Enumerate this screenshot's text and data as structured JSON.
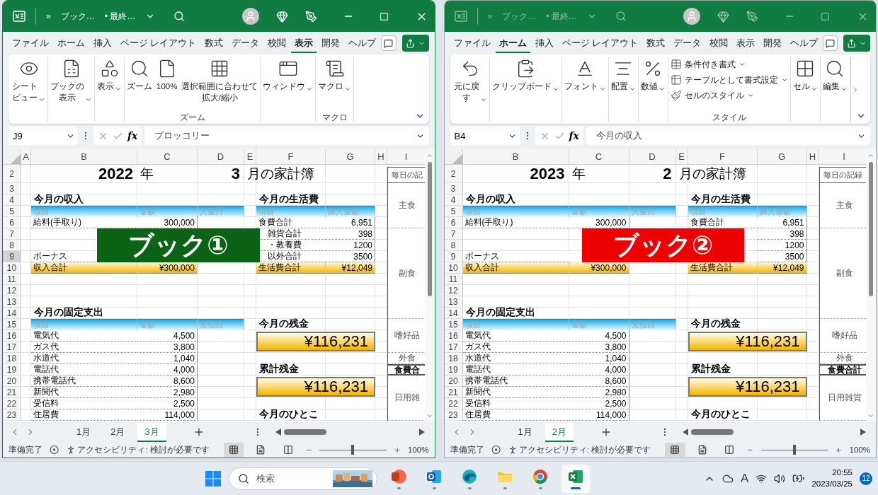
{
  "windows": [
    {
      "active": true,
      "title": {
        "more": "»",
        "name": "ブック…",
        "status": "• 最終…"
      },
      "menu_tabs": [
        {
          "label": "ファイル",
          "selected": false
        },
        {
          "label": "ホーム",
          "selected": false
        },
        {
          "label": "挿入",
          "selected": false
        },
        {
          "label": "ページ レイアウト",
          "selected": false
        },
        {
          "label": "数式",
          "selected": false
        },
        {
          "label": "データ",
          "selected": false
        },
        {
          "label": "校閲",
          "selected": false
        },
        {
          "label": "表示",
          "selected": true
        },
        {
          "label": "開発",
          "selected": false
        },
        {
          "label": "ヘルプ",
          "selected": false
        }
      ],
      "ribbon": {
        "more": false,
        "groups": [
          {
            "kind": "row",
            "items": [
              {
                "kind": "eye",
                "lines": [
                  "シート",
                  "ビュー"
                ],
                "dropdown": true
              }
            ]
          },
          {
            "kind": "row",
            "items": [
              {
                "kind": "book",
                "lines": [
                  "ブックの",
                  "表示"
                ],
                "dropdown": true
              }
            ]
          },
          {
            "kind": "row",
            "items": [
              {
                "kind": "display",
                "lines": [
                  "表示"
                ],
                "dropdown": true
              }
            ]
          },
          {
            "kind": "row",
            "label": "ズーム",
            "items": [
              {
                "kind": "zoom",
                "lines": [
                  "ズーム"
                ],
                "dropdown": false
              },
              {
                "kind": "page",
                "lines": [
                  "100%"
                ],
                "dropdown": false
              },
              {
                "kind": "fit",
                "lines": [
                  "選択範囲に合わせて",
                  "拡大/縮小"
                ],
                "dropdown": false
              }
            ]
          },
          {
            "kind": "row",
            "items": [
              {
                "kind": "window",
                "lines": [
                  "ウィンドウ"
                ],
                "dropdown": true
              }
            ]
          },
          {
            "kind": "row",
            "label": "マクロ",
            "items": [
              {
                "kind": "macro",
                "lines": [
                  "マクロ"
                ],
                "dropdown": true
              }
            ]
          }
        ]
      },
      "formula_bar": {
        "name_box": "J9",
        "fx": "fx",
        "value": "ブロッコリー"
      },
      "sheet": {
        "columns": [
          {
            "label": "A",
            "kind": "tiny"
          },
          {
            "label": "B",
            "kind": "wide"
          },
          {
            "label": "C",
            "kind": "mid"
          },
          {
            "label": "D",
            "kind": "short"
          },
          {
            "label": "E",
            "kind": "narrow"
          },
          {
            "label": "F",
            "kind": "broad"
          },
          {
            "label": "G",
            "kind": "medium"
          },
          {
            "label": "H",
            "kind": "narrow"
          },
          {
            "label": "I",
            "kind": "clipped"
          }
        ],
        "rows": [
          {
            "label": "2",
            "tall": true,
            "selected": false
          },
          {
            "label": "3",
            "tall": false,
            "selected": false
          },
          {
            "label": "4",
            "tall": false,
            "selected": false
          },
          {
            "label": "5",
            "tall": false,
            "selected": false
          },
          {
            "label": "6",
            "tall": false,
            "selected": false
          },
          {
            "label": "7",
            "tall": false,
            "selected": false
          },
          {
            "label": "8",
            "tall": false,
            "selected": false
          },
          {
            "label": "9",
            "tall": false,
            "selected": true
          },
          {
            "label": "10",
            "tall": false,
            "selected": false
          },
          {
            "label": "11",
            "tall": false,
            "selected": false
          },
          {
            "label": "12",
            "tall": false,
            "selected": false
          },
          {
            "label": "13",
            "tall": false,
            "selected": false
          },
          {
            "label": "14",
            "tall": false,
            "selected": false
          },
          {
            "label": "15",
            "tall": false,
            "selected": false
          },
          {
            "label": "16",
            "tall": false,
            "selected": false
          },
          {
            "label": "17",
            "tall": false,
            "selected": false
          },
          {
            "label": "18",
            "tall": false,
            "selected": false
          },
          {
            "label": "19",
            "tall": false,
            "selected": false
          },
          {
            "label": "20",
            "tall": false,
            "selected": false
          },
          {
            "label": "21",
            "tall": false,
            "selected": false
          },
          {
            "label": "22",
            "tall": false,
            "selected": false
          },
          {
            "label": "23",
            "tall": false,
            "selected": false
          }
        ],
        "cells": [
          {
            "text": "2022",
            "kind": "title_value"
          },
          {
            "text": "年",
            "kind": "title_text"
          },
          {
            "text": "3",
            "kind": "title_value"
          },
          {
            "text": "月の家計簿",
            "kind": "title_text"
          },
          {
            "text": "毎日の記",
            "kind": "side_header"
          },
          {
            "text": "主食",
            "kind": "side"
          },
          {
            "text": "今月の収入",
            "kind": "heading"
          },
          {
            "text": "今月の生活費",
            "kind": "heading"
          },
          {
            "text": "項目",
            "kind": "header"
          },
          {
            "text": "金額",
            "kind": "header"
          },
          {
            "text": "入金日",
            "kind": "header"
          },
          {
            "text": "項目",
            "kind": "header"
          },
          {
            "text": "購入金額",
            "kind": "header"
          },
          {
            "text": "給料(手取り)",
            "kind": "label"
          },
          {
            "text": "300,000",
            "kind": "amount"
          },
          {
            "text": "食費合計",
            "kind": "label"
          },
          {
            "text": "6,951",
            "kind": "amount"
          },
          {
            "text": "雑貨合計",
            "kind": "label_partial"
          },
          {
            "text": "398",
            "kind": "amount"
          },
          {
            "text": "副食",
            "kind": "side"
          },
          {
            "text": "・教養費",
            "kind": "label_partial"
          },
          {
            "text": "1200",
            "kind": "amount"
          },
          {
            "text": "ボーナス",
            "kind": "label"
          },
          {
            "text": "以外合計",
            "kind": "label_partial"
          },
          {
            "text": "3500",
            "kind": "amount"
          },
          {
            "text": "収入合計",
            "kind": "total_label"
          },
          {
            "text": "¥300,000",
            "kind": "total_amount"
          },
          {
            "text": "生活費合計",
            "kind": "total_label"
          },
          {
            "text": "¥12,049",
            "kind": "total_amount"
          },
          {
            "text": "今月の固定支出",
            "kind": "heading"
          },
          {
            "text": "項目",
            "kind": "header"
          },
          {
            "text": "金額",
            "kind": "header"
          },
          {
            "text": "支払日",
            "kind": "header"
          },
          {
            "text": "今月の残金",
            "kind": "heading"
          },
          {
            "text": "電気代",
            "kind": "label"
          },
          {
            "text": "4,500",
            "kind": "amount"
          },
          {
            "text": "¥116,231",
            "kind": "balance"
          },
          {
            "text": "嗜好品",
            "kind": "side"
          },
          {
            "text": "ガス代",
            "kind": "label"
          },
          {
            "text": "3,800",
            "kind": "amount"
          },
          {
            "text": "水道代",
            "kind": "label"
          },
          {
            "text": "1,040",
            "kind": "amount"
          },
          {
            "text": "外食",
            "kind": "side"
          },
          {
            "text": "電話代",
            "kind": "label"
          },
          {
            "text": "4,000",
            "kind": "amount"
          },
          {
            "text": "累計残金",
            "kind": "heading"
          },
          {
            "text": "食費合",
            "kind": "side_total"
          },
          {
            "text": "携帯電話代",
            "kind": "label"
          },
          {
            "text": "8,600",
            "kind": "amount"
          },
          {
            "text": "¥116,231",
            "kind": "balance"
          },
          {
            "text": "日用雑",
            "kind": "side"
          },
          {
            "text": "新聞代",
            "kind": "label"
          },
          {
            "text": "2,980",
            "kind": "amount"
          },
          {
            "text": "受信料",
            "kind": "label"
          },
          {
            "text": "2,500",
            "kind": "amount"
          },
          {
            "text": "住居費",
            "kind": "label"
          },
          {
            "text": "114,000",
            "kind": "amount"
          },
          {
            "text": "今月のひとこ",
            "kind": "heading"
          }
        ]
      },
      "banner": {
        "text": "ブック①",
        "color": "#0b6416"
      },
      "sheet_tabs": [
        {
          "label": "1月",
          "selected": false
        },
        {
          "label": "2月",
          "selected": false
        },
        {
          "label": "3月",
          "selected": true
        }
      ],
      "status_bar": {
        "ready": "準備完了",
        "accessibility": "アクセシビリティ: 検討が必要です",
        "views": [
          {
            "kind": "normal",
            "selected": true
          },
          {
            "kind": "layout",
            "selected": false
          },
          {
            "kind": "break",
            "selected": false
          }
        ],
        "zoom": {
          "level": 0.5,
          "reading": "100%"
        }
      }
    },
    {
      "active": false,
      "title": {
        "more": "»",
        "name": "ブック…",
        "status": "• 最終…"
      },
      "menu_tabs": [
        {
          "label": "ファイル",
          "selected": false
        },
        {
          "label": "ホーム",
          "selected": true
        },
        {
          "label": "挿入",
          "selected": false
        },
        {
          "label": "ページ レイアウト",
          "selected": false
        },
        {
          "label": "数式",
          "selected": false
        },
        {
          "label": "データ",
          "selected": false
        },
        {
          "label": "校閲",
          "selected": false
        },
        {
          "label": "表示",
          "selected": false
        },
        {
          "label": "開発",
          "selected": false
        },
        {
          "label": "ヘルプ",
          "selected": false
        }
      ],
      "ribbon": {
        "more": true,
        "groups": [
          {
            "kind": "row",
            "items": [
              {
                "kind": "undo",
                "lines": [
                  "元に戻",
                  "す"
                ],
                "dropdown": true
              }
            ]
          },
          {
            "kind": "row",
            "items": [
              {
                "kind": "clipboard",
                "lines": [
                  "クリップボード"
                ],
                "dropdown": true
              }
            ]
          },
          {
            "kind": "row",
            "items": [
              {
                "kind": "font",
                "lines": [
                  "フォント"
                ],
                "dropdown": true
              }
            ]
          },
          {
            "kind": "row",
            "items": [
              {
                "kind": "align",
                "lines": [
                  "配置"
                ],
                "dropdown": true
              }
            ]
          },
          {
            "kind": "row",
            "items": [
              {
                "kind": "number",
                "lines": [
                  "数値"
                ],
                "dropdown": true
              }
            ]
          },
          {
            "kind": "stack",
            "label": "スタイル",
            "items": [
              {
                "kind": "conditional",
                "lines": [
                  "条件付き書式"
                ],
                "dropdown": true
              },
              {
                "kind": "table",
                "lines": [
                  "テーブルとして書式設定"
                ],
                "dropdown": true
              },
              {
                "kind": "style",
                "lines": [
                  "セルのスタイル"
                ],
                "dropdown": true
              }
            ]
          },
          {
            "kind": "row",
            "items": [
              {
                "kind": "cells",
                "lines": [
                  "セル"
                ],
                "dropdown": true
              }
            ]
          },
          {
            "kind": "row",
            "items": [
              {
                "kind": "edit",
                "lines": [
                  "編集"
                ],
                "dropdown": true
              }
            ]
          }
        ]
      },
      "formula_bar": {
        "name_box": "B4",
        "fx": "fx",
        "value": "今月の収入"
      },
      "sheet": {
        "columns": [
          {
            "label": "B",
            "kind": "wide"
          },
          {
            "label": "C",
            "kind": "mid"
          },
          {
            "label": "D",
            "kind": "short"
          },
          {
            "label": "E",
            "kind": "narrow"
          },
          {
            "label": "F",
            "kind": "broad"
          },
          {
            "label": "G",
            "kind": "medium"
          },
          {
            "label": "H",
            "kind": "narrow"
          },
          {
            "label": "I",
            "kind": "side"
          }
        ],
        "rows": [
          {
            "label": "2",
            "tall": true,
            "selected": false
          },
          {
            "label": "3",
            "tall": false,
            "selected": false
          },
          {
            "label": "4",
            "tall": false,
            "selected": false
          },
          {
            "label": "5",
            "tall": false,
            "selected": false
          },
          {
            "label": "6",
            "tall": false,
            "selected": false
          },
          {
            "label": "7",
            "tall": false,
            "selected": false
          },
          {
            "label": "8",
            "tall": false,
            "selected": false
          },
          {
            "label": "9",
            "tall": false,
            "selected": false
          },
          {
            "label": "10",
            "tall": false,
            "selected": false
          },
          {
            "label": "11",
            "tall": false,
            "selected": false
          },
          {
            "label": "12",
            "tall": false,
            "selected": false
          },
          {
            "label": "13",
            "tall": false,
            "selected": false
          },
          {
            "label": "14",
            "tall": false,
            "selected": false
          },
          {
            "label": "15",
            "tall": false,
            "selected": false
          },
          {
            "label": "16",
            "tall": false,
            "selected": false
          },
          {
            "label": "17",
            "tall": false,
            "selected": false
          },
          {
            "label": "18",
            "tall": false,
            "selected": false
          },
          {
            "label": "19",
            "tall": false,
            "selected": false
          },
          {
            "label": "20",
            "tall": false,
            "selected": false
          },
          {
            "label": "21",
            "tall": false,
            "selected": false
          },
          {
            "label": "22",
            "tall": false,
            "selected": false
          },
          {
            "label": "23",
            "tall": false,
            "selected": false
          }
        ],
        "cells": [
          {
            "text": "2023",
            "kind": "title_value"
          },
          {
            "text": "年",
            "kind": "title_text"
          },
          {
            "text": "2",
            "kind": "title_value"
          },
          {
            "text": "月の家計簿",
            "kind": "title_text"
          },
          {
            "text": "毎日の記録",
            "kind": "side_header"
          },
          {
            "text": "主食",
            "kind": "side"
          },
          {
            "text": "今月の収入",
            "kind": "heading"
          },
          {
            "text": "今月の生活費",
            "kind": "heading"
          },
          {
            "text": "項目",
            "kind": "header"
          },
          {
            "text": "金額",
            "kind": "header"
          },
          {
            "text": "入金日",
            "kind": "header"
          },
          {
            "text": "項目",
            "kind": "header"
          },
          {
            "text": "購入金額",
            "kind": "header"
          },
          {
            "text": "給料(手取り)",
            "kind": "label"
          },
          {
            "text": "300,000",
            "kind": "amount"
          },
          {
            "text": "食費合計",
            "kind": "label"
          },
          {
            "text": "6,951",
            "kind": "amount"
          },
          {
            "text": "398",
            "kind": "amount"
          },
          {
            "text": "副食",
            "kind": "side"
          },
          {
            "text": "1200",
            "kind": "amount"
          },
          {
            "text": "ボーナス",
            "kind": "label"
          },
          {
            "text": "3500",
            "kind": "amount"
          },
          {
            "text": "収入合計",
            "kind": "total_label"
          },
          {
            "text": "¥300,000",
            "kind": "total_amount"
          },
          {
            "text": "生活費合計",
            "kind": "total_label"
          },
          {
            "text": "¥12,049",
            "kind": "total_amount"
          },
          {
            "text": "今月の固定支出",
            "kind": "heading"
          },
          {
            "text": "項目",
            "kind": "header"
          },
          {
            "text": "金額",
            "kind": "header"
          },
          {
            "text": "支払日",
            "kind": "header"
          },
          {
            "text": "今月の残金",
            "kind": "heading"
          },
          {
            "text": "電気代",
            "kind": "label"
          },
          {
            "text": "4,500",
            "kind": "amount"
          },
          {
            "text": "¥116,231",
            "kind": "balance"
          },
          {
            "text": "嗜好品",
            "kind": "side"
          },
          {
            "text": "ガス代",
            "kind": "label"
          },
          {
            "text": "3,800",
            "kind": "amount"
          },
          {
            "text": "水道代",
            "kind": "label"
          },
          {
            "text": "1,040",
            "kind": "amount"
          },
          {
            "text": "外食",
            "kind": "side"
          },
          {
            "text": "電話代",
            "kind": "label"
          },
          {
            "text": "4,000",
            "kind": "amount"
          },
          {
            "text": "累計残金",
            "kind": "heading"
          },
          {
            "text": "食費合計",
            "kind": "side_total"
          },
          {
            "text": "携帯電話代",
            "kind": "label"
          },
          {
            "text": "8,600",
            "kind": "amount"
          },
          {
            "text": "¥116,231",
            "kind": "balance"
          },
          {
            "text": "日用雑貨",
            "kind": "side"
          },
          {
            "text": "新聞代",
            "kind": "label"
          },
          {
            "text": "2,980",
            "kind": "amount"
          },
          {
            "text": "受信料",
            "kind": "label"
          },
          {
            "text": "2,500",
            "kind": "amount"
          },
          {
            "text": "住居費",
            "kind": "label"
          },
          {
            "text": "114,000",
            "kind": "amount"
          },
          {
            "text": "今月のひとこ",
            "kind": "heading"
          }
        ]
      },
      "banner": {
        "text": "ブック②",
        "color": "#ee0000"
      },
      "sheet_tabs": [
        {
          "label": "1月",
          "selected": false
        },
        {
          "label": "2月",
          "selected": true
        }
      ],
      "status_bar": {
        "ready": "準備完了",
        "accessibility": "アクセシビリティ: 検討が必要です",
        "views": [
          {
            "kind": "normal",
            "selected": true
          },
          {
            "kind": "layout",
            "selected": false
          },
          {
            "kind": "break",
            "selected": false
          }
        ],
        "zoom": {
          "level": 0.5,
          "reading": "100%"
        }
      }
    }
  ],
  "taskbar": {
    "search": {
      "placeholder": "検索"
    },
    "apps": [
      {
        "kind": "slides",
        "active": false
      },
      {
        "kind": "mail",
        "active": false
      },
      {
        "kind": "browser",
        "active": false
      },
      {
        "kind": "folder",
        "active": false
      },
      {
        "kind": "globe",
        "active": false
      },
      {
        "kind": "sheet",
        "active": true
      }
    ],
    "ime": "A",
    "time": "20:55",
    "date": "2023/03/25",
    "badge": "12"
  }
}
